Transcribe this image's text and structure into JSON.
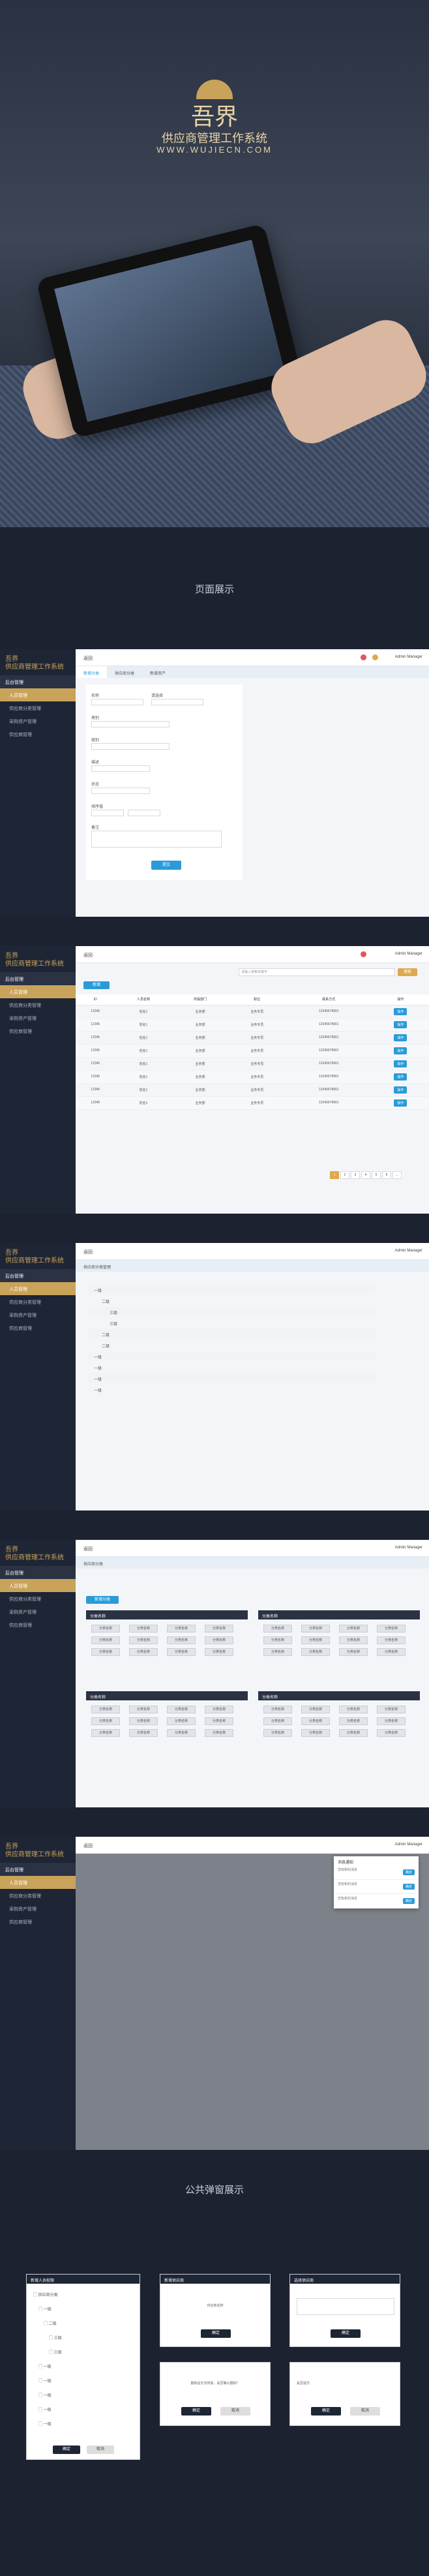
{
  "hero": {
    "logo": "吾界",
    "subtitle": "供应商管理工作系统",
    "url": "WWW.WUJIECN.COM"
  },
  "sections": {
    "pages_title": "页面展示",
    "modals_title": "公共弹窗展示"
  },
  "colors": {
    "accent": "#c9a35a",
    "primary": "#2a9bd8",
    "sidebar": "#1e2535"
  },
  "sidebar": {
    "logo_line1": "吾界",
    "logo_line2": "供应商管理工作系统",
    "group": "后台管理",
    "items": [
      "人员管理",
      "供应商分类管理",
      "采购资产管理",
      "供应商管理"
    ]
  },
  "topbar": {
    "back": "返回",
    "user": "Admin Manager"
  },
  "form_screen": {
    "tabs": [
      "新增分类",
      "供应商分类",
      "新增资产"
    ],
    "labels": [
      "名称",
      "请选择",
      "类别",
      "级别",
      "描述",
      "状态",
      "排序值",
      "备注"
    ],
    "submit": "提交"
  },
  "list_screen": {
    "search_placeholder": "请输入搜索关键字",
    "search_btn": "搜索",
    "add_btn": "新增",
    "columns": [
      "ID",
      "人员名称",
      "所属部门",
      "职位",
      "联系方式",
      "操作"
    ],
    "rows": [
      [
        "12345",
        "姓名1",
        "业务部",
        "业务专员",
        "12345678901",
        "操作"
      ],
      [
        "12345",
        "姓名1",
        "业务部",
        "业务专员",
        "12345678901",
        "操作"
      ],
      [
        "12345",
        "姓名1",
        "业务部",
        "业务专员",
        "12345678901",
        "操作"
      ],
      [
        "12345",
        "姓名1",
        "业务部",
        "业务专员",
        "12345678901",
        "操作"
      ],
      [
        "12345",
        "姓名1",
        "业务部",
        "业务专员",
        "12345678901",
        "操作"
      ],
      [
        "12345",
        "姓名1",
        "业务部",
        "业务专员",
        "12345678901",
        "操作"
      ],
      [
        "12345",
        "姓名1",
        "业务部",
        "业务专员",
        "12345678901",
        "操作"
      ],
      [
        "12345",
        "姓名1",
        "业务部",
        "业务专员",
        "12345678901",
        "操作"
      ]
    ],
    "pages": [
      "1",
      "2",
      "3",
      "4",
      "5",
      "6",
      "..."
    ]
  },
  "tree_screen": {
    "title": "供应商分类管理",
    "rows": [
      "一级",
      "二级",
      "三级",
      "三级",
      "二级",
      "二级",
      "一级",
      "一级",
      "一级",
      "一级"
    ]
  },
  "cards_screen": {
    "header": "供应商分类",
    "add": "新增分类",
    "card_title": "分类名称",
    "chip": "分类名称"
  },
  "notice_screen": {
    "title": "消息通知",
    "items": [
      "您有新的消息",
      "您有新的消息",
      "您有新的消息"
    ],
    "ok": "确定"
  },
  "modals": {
    "m1_title": "新增人员权限",
    "m2_title": "新增供应商",
    "m3_title": "选择供应商",
    "m2_text": "供应商名称",
    "m4_text": "删除后无法恢复，是否确认删除？",
    "m5_text": "是否提交",
    "confirm": "确定",
    "cancel": "取消",
    "tree_items": [
      "供应商分类",
      "一级",
      "二级",
      "三级",
      "三级",
      "一级",
      "一级",
      "一级",
      "一级",
      "一级"
    ]
  }
}
